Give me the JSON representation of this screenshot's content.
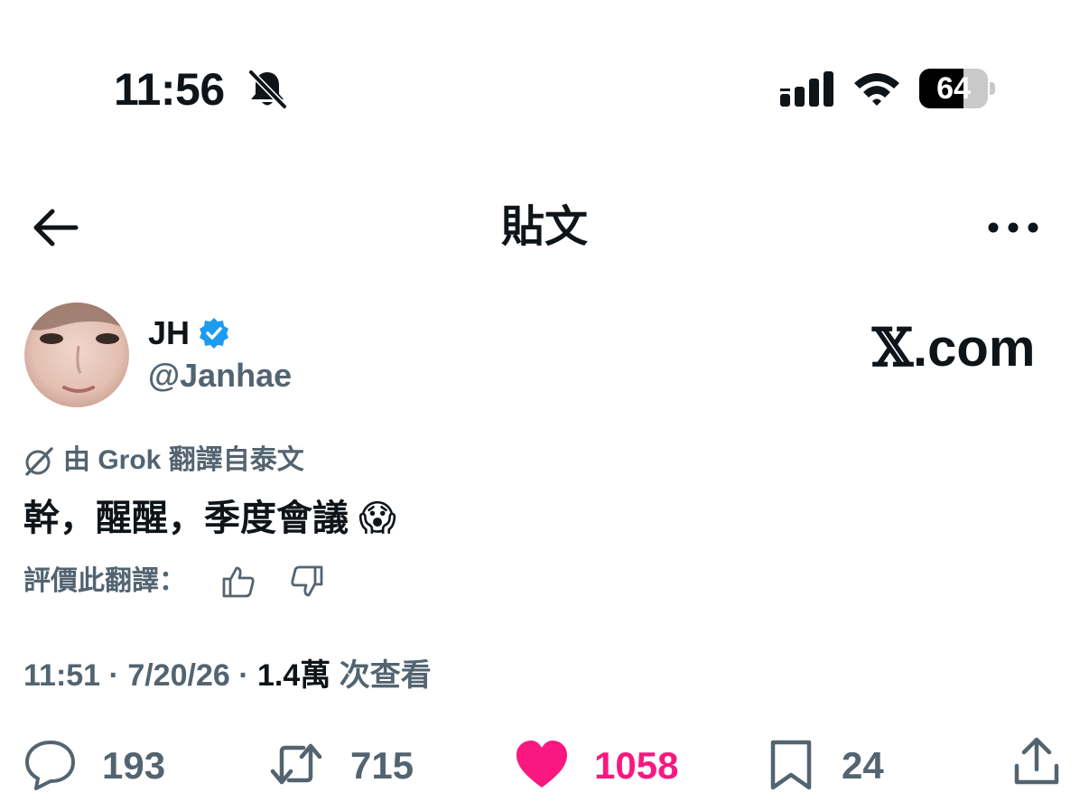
{
  "status_bar": {
    "time": "11:56",
    "battery_percent": "64",
    "battery_level": 0.64,
    "icons": [
      "bell-slash-icon",
      "cellular-signal-icon",
      "wifi-icon",
      "battery-icon"
    ]
  },
  "header": {
    "title": "貼文",
    "back_icon": "arrow-left-icon",
    "more_icon": "more-horizontal-icon"
  },
  "author": {
    "name": "JH",
    "handle": "@Janhae",
    "verified": true
  },
  "watermark": {
    "x_mark": "𝕏",
    "domain": ".com"
  },
  "translation": {
    "source_label": "由 Grok 翻譯自泰文",
    "text": "幹，醒醒，季度會議",
    "emoji": "😱",
    "rate_label": "評價此翻譯："
  },
  "meta": {
    "time": "11:51",
    "separator": "·",
    "date": "7/20/26",
    "views_count": "1.4萬",
    "views_label": "次查看"
  },
  "actions": {
    "replies": "193",
    "reposts": "715",
    "likes": "1058",
    "bookmarks": "24"
  },
  "colors": {
    "text_primary": "#0f1419",
    "text_secondary": "#536471",
    "like_pink": "#f91880",
    "verified_blue": "#1d9bf0"
  }
}
